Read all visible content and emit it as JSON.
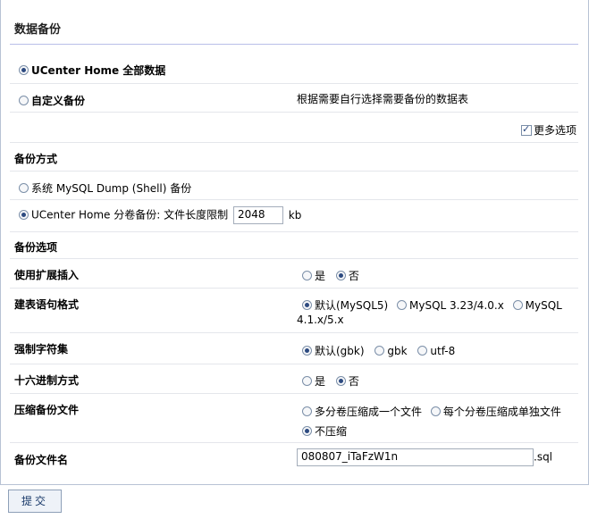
{
  "page_title": "数据备份",
  "backup_scope": {
    "full": {
      "label": "UCenter Home 全部数据",
      "selected": true
    },
    "custom": {
      "label": "自定义备份",
      "selected": false,
      "description": "根据需要自行选择需要备份的数据表"
    }
  },
  "more_options": {
    "label": "更多选项",
    "checked": true
  },
  "backup_method": {
    "heading": "备份方式",
    "mysqldump": {
      "label": "系统 MySQL Dump (Shell) 备份",
      "selected": false
    },
    "multivolume": {
      "label": "UCenter Home 分卷备份: 文件长度限制",
      "selected": true,
      "size_value": "2048",
      "unit": "kb"
    }
  },
  "backup_options": {
    "heading": "备份选项",
    "extended_insert": {
      "label": "使用扩展插入",
      "options": [
        "是",
        "否"
      ],
      "selected": "否"
    },
    "sql_format": {
      "label": "建表语句格式",
      "options": [
        "默认(MySQL5)",
        "MySQL 3.23/4.0.x",
        "MySQL"
      ],
      "continuation": "4.1.x/5.x",
      "selected": "默认(MySQL5)"
    },
    "charset": {
      "label": "强制字符集",
      "options": [
        "默认(gbk)",
        "gbk",
        "utf-8"
      ],
      "selected": "默认(gbk)"
    },
    "hex": {
      "label": "十六进制方式",
      "options": [
        "是",
        "否"
      ],
      "selected": "否"
    },
    "compress": {
      "label": "压缩备份文件",
      "options": [
        "多分卷压缩成一个文件",
        "每个分卷压缩成单独文件",
        "不压缩"
      ],
      "selected": "不压缩"
    },
    "filename": {
      "label": "备份文件名",
      "value": "080807_iTaFzW1n",
      "suffix": ".sql"
    }
  },
  "submit_label": "提交"
}
